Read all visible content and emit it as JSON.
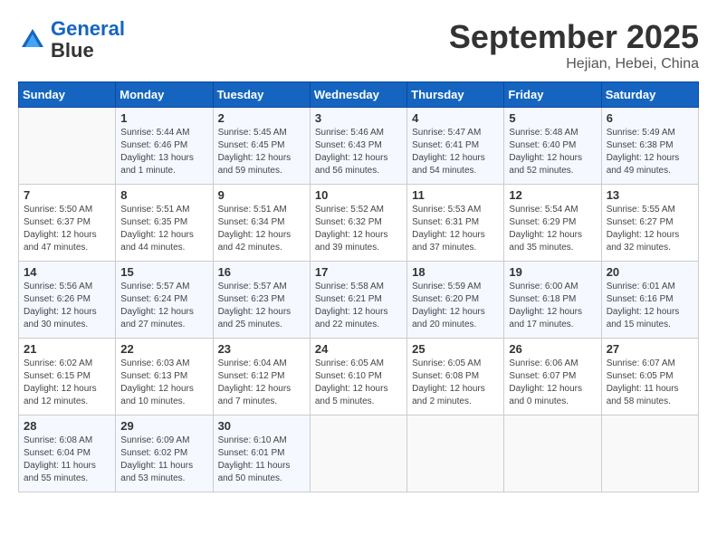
{
  "header": {
    "logo_line1": "General",
    "logo_line2": "Blue",
    "month": "September 2025",
    "location": "Hejian, Hebei, China"
  },
  "weekdays": [
    "Sunday",
    "Monday",
    "Tuesday",
    "Wednesday",
    "Thursday",
    "Friday",
    "Saturday"
  ],
  "weeks": [
    [
      {
        "day": "",
        "info": ""
      },
      {
        "day": "1",
        "info": "Sunrise: 5:44 AM\nSunset: 6:46 PM\nDaylight: 13 hours\nand 1 minute."
      },
      {
        "day": "2",
        "info": "Sunrise: 5:45 AM\nSunset: 6:45 PM\nDaylight: 12 hours\nand 59 minutes."
      },
      {
        "day": "3",
        "info": "Sunrise: 5:46 AM\nSunset: 6:43 PM\nDaylight: 12 hours\nand 56 minutes."
      },
      {
        "day": "4",
        "info": "Sunrise: 5:47 AM\nSunset: 6:41 PM\nDaylight: 12 hours\nand 54 minutes."
      },
      {
        "day": "5",
        "info": "Sunrise: 5:48 AM\nSunset: 6:40 PM\nDaylight: 12 hours\nand 52 minutes."
      },
      {
        "day": "6",
        "info": "Sunrise: 5:49 AM\nSunset: 6:38 PM\nDaylight: 12 hours\nand 49 minutes."
      }
    ],
    [
      {
        "day": "7",
        "info": "Sunrise: 5:50 AM\nSunset: 6:37 PM\nDaylight: 12 hours\nand 47 minutes."
      },
      {
        "day": "8",
        "info": "Sunrise: 5:51 AM\nSunset: 6:35 PM\nDaylight: 12 hours\nand 44 minutes."
      },
      {
        "day": "9",
        "info": "Sunrise: 5:51 AM\nSunset: 6:34 PM\nDaylight: 12 hours\nand 42 minutes."
      },
      {
        "day": "10",
        "info": "Sunrise: 5:52 AM\nSunset: 6:32 PM\nDaylight: 12 hours\nand 39 minutes."
      },
      {
        "day": "11",
        "info": "Sunrise: 5:53 AM\nSunset: 6:31 PM\nDaylight: 12 hours\nand 37 minutes."
      },
      {
        "day": "12",
        "info": "Sunrise: 5:54 AM\nSunset: 6:29 PM\nDaylight: 12 hours\nand 35 minutes."
      },
      {
        "day": "13",
        "info": "Sunrise: 5:55 AM\nSunset: 6:27 PM\nDaylight: 12 hours\nand 32 minutes."
      }
    ],
    [
      {
        "day": "14",
        "info": "Sunrise: 5:56 AM\nSunset: 6:26 PM\nDaylight: 12 hours\nand 30 minutes."
      },
      {
        "day": "15",
        "info": "Sunrise: 5:57 AM\nSunset: 6:24 PM\nDaylight: 12 hours\nand 27 minutes."
      },
      {
        "day": "16",
        "info": "Sunrise: 5:57 AM\nSunset: 6:23 PM\nDaylight: 12 hours\nand 25 minutes."
      },
      {
        "day": "17",
        "info": "Sunrise: 5:58 AM\nSunset: 6:21 PM\nDaylight: 12 hours\nand 22 minutes."
      },
      {
        "day": "18",
        "info": "Sunrise: 5:59 AM\nSunset: 6:20 PM\nDaylight: 12 hours\nand 20 minutes."
      },
      {
        "day": "19",
        "info": "Sunrise: 6:00 AM\nSunset: 6:18 PM\nDaylight: 12 hours\nand 17 minutes."
      },
      {
        "day": "20",
        "info": "Sunrise: 6:01 AM\nSunset: 6:16 PM\nDaylight: 12 hours\nand 15 minutes."
      }
    ],
    [
      {
        "day": "21",
        "info": "Sunrise: 6:02 AM\nSunset: 6:15 PM\nDaylight: 12 hours\nand 12 minutes."
      },
      {
        "day": "22",
        "info": "Sunrise: 6:03 AM\nSunset: 6:13 PM\nDaylight: 12 hours\nand 10 minutes."
      },
      {
        "day": "23",
        "info": "Sunrise: 6:04 AM\nSunset: 6:12 PM\nDaylight: 12 hours\nand 7 minutes."
      },
      {
        "day": "24",
        "info": "Sunrise: 6:05 AM\nSunset: 6:10 PM\nDaylight: 12 hours\nand 5 minutes."
      },
      {
        "day": "25",
        "info": "Sunrise: 6:05 AM\nSunset: 6:08 PM\nDaylight: 12 hours\nand 2 minutes."
      },
      {
        "day": "26",
        "info": "Sunrise: 6:06 AM\nSunset: 6:07 PM\nDaylight: 12 hours\nand 0 minutes."
      },
      {
        "day": "27",
        "info": "Sunrise: 6:07 AM\nSunset: 6:05 PM\nDaylight: 11 hours\nand 58 minutes."
      }
    ],
    [
      {
        "day": "28",
        "info": "Sunrise: 6:08 AM\nSunset: 6:04 PM\nDaylight: 11 hours\nand 55 minutes."
      },
      {
        "day": "29",
        "info": "Sunrise: 6:09 AM\nSunset: 6:02 PM\nDaylight: 11 hours\nand 53 minutes."
      },
      {
        "day": "30",
        "info": "Sunrise: 6:10 AM\nSunset: 6:01 PM\nDaylight: 11 hours\nand 50 minutes."
      },
      {
        "day": "",
        "info": ""
      },
      {
        "day": "",
        "info": ""
      },
      {
        "day": "",
        "info": ""
      },
      {
        "day": "",
        "info": ""
      }
    ]
  ]
}
